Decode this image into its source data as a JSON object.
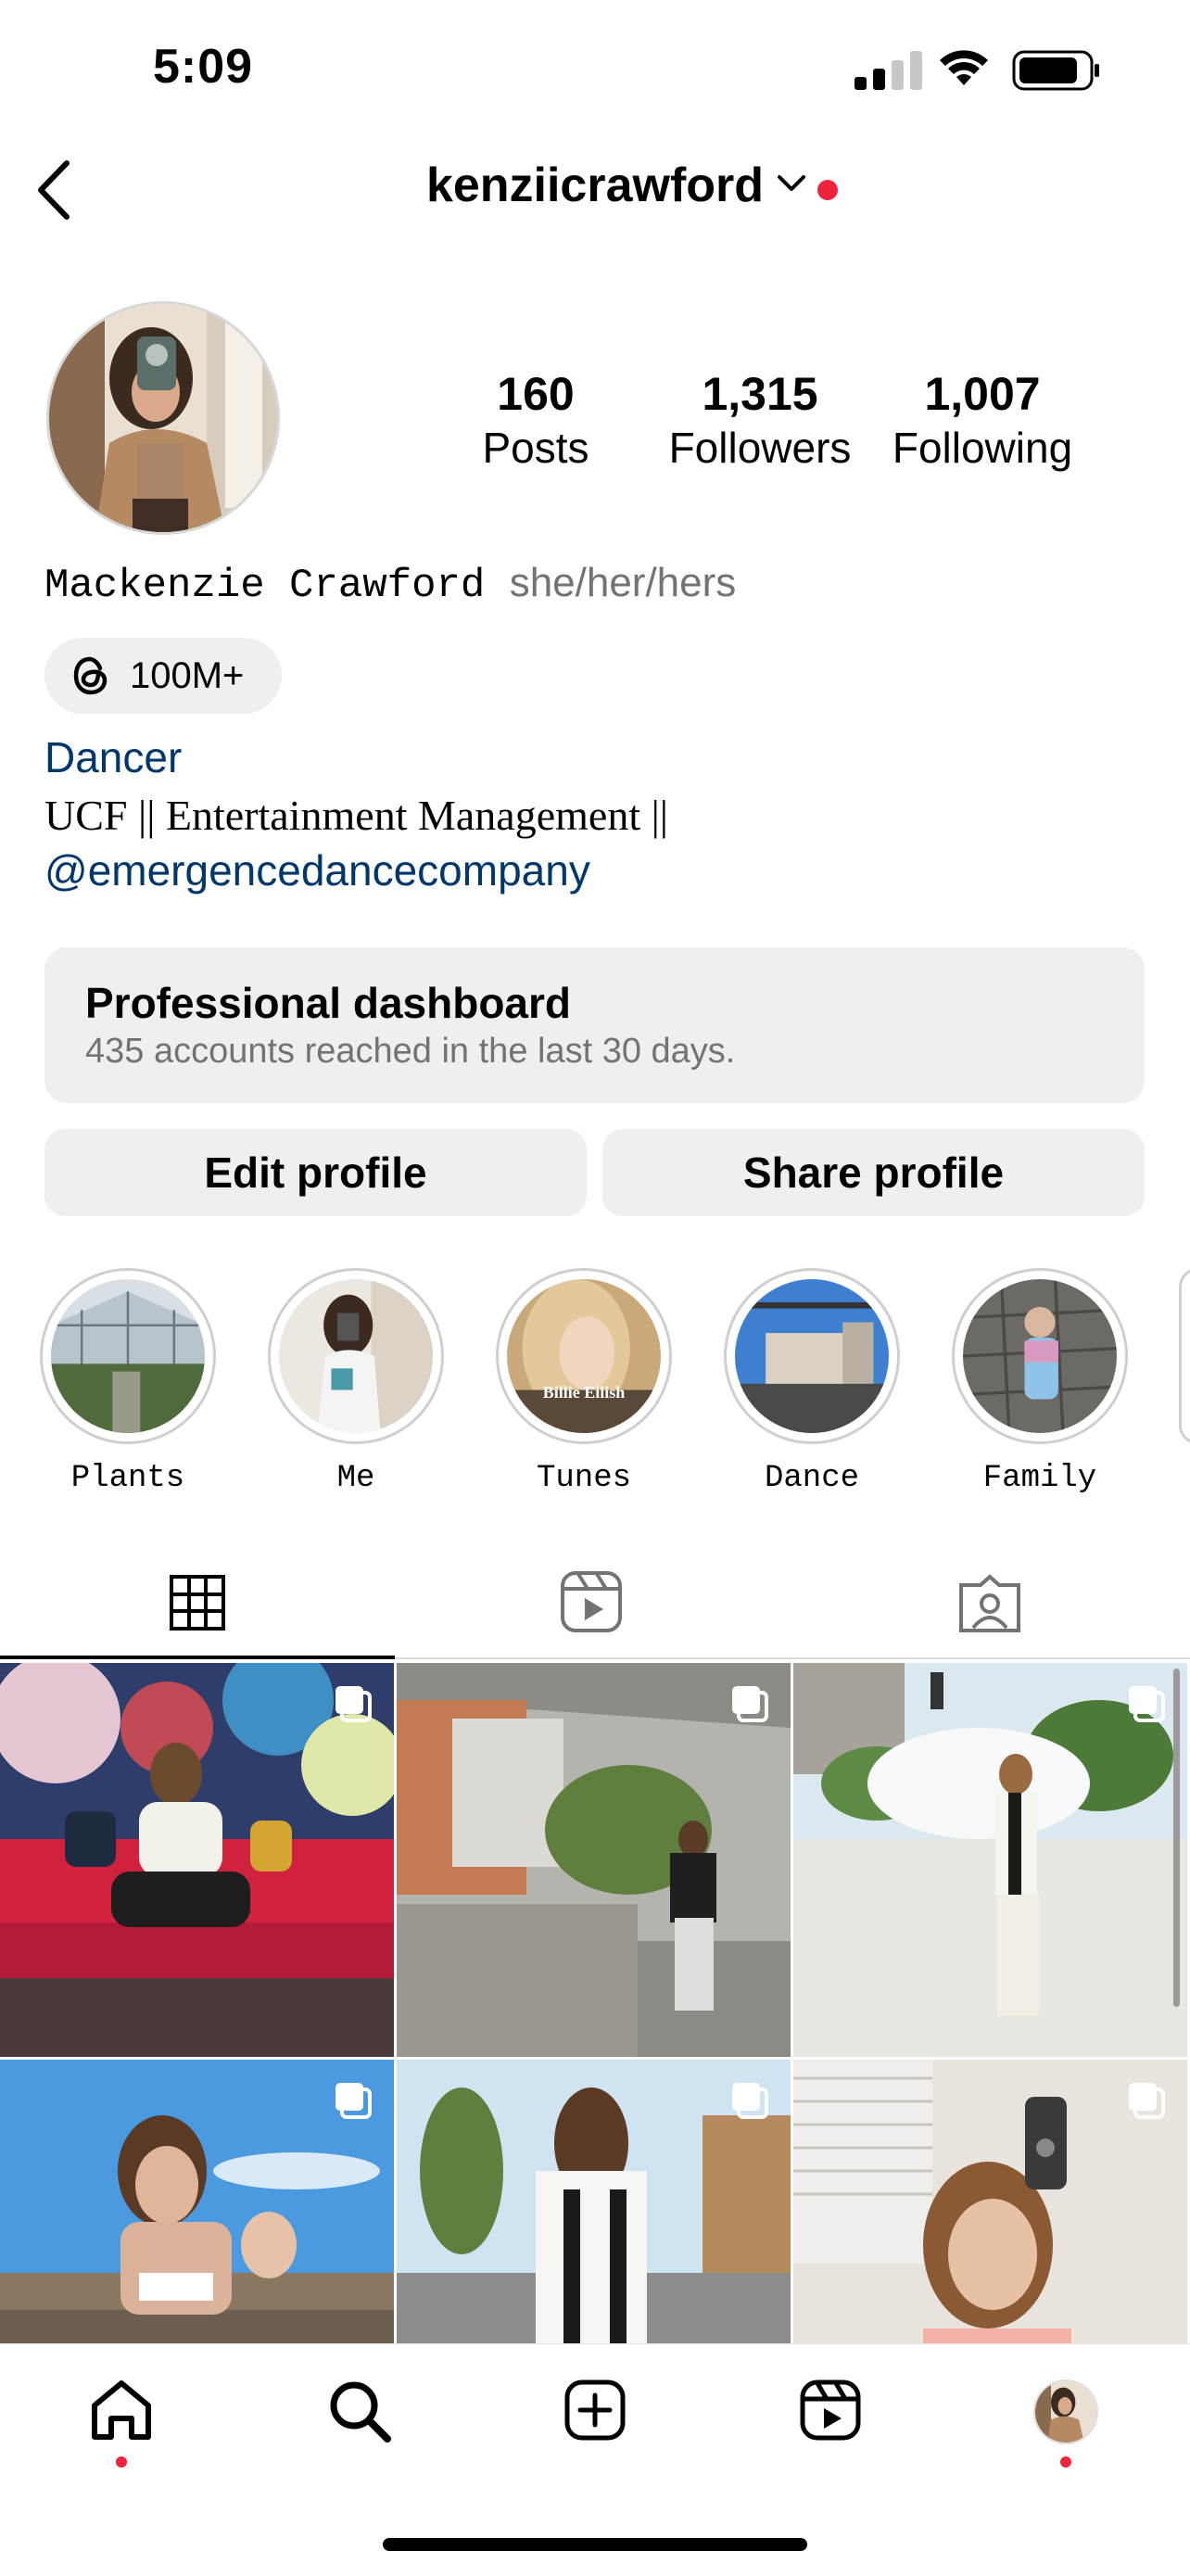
{
  "status_bar": {
    "time": "5:09"
  },
  "header": {
    "username": "kenziicrawford"
  },
  "profile": {
    "stats": [
      {
        "number": "160",
        "label": "Posts"
      },
      {
        "number": "1,315",
        "label": "Followers"
      },
      {
        "number": "1,007",
        "label": "Following"
      }
    ],
    "full_name": "Mackenzie Crawford",
    "pronouns": "she/her/hers",
    "threads_count": "100M+",
    "category": "Dancer",
    "bio": "UCF || Entertainment Management ||",
    "bio_link": "@emergencedancecompany"
  },
  "dashboard": {
    "title": "Professional dashboard",
    "subtitle": "435 accounts reached in the last 30 days."
  },
  "buttons": {
    "edit": "Edit profile",
    "share": "Share profile"
  },
  "highlights": [
    {
      "label": "Plants"
    },
    {
      "label": "Me"
    },
    {
      "label": "Tunes"
    },
    {
      "label": "Dance"
    },
    {
      "label": "Family"
    }
  ],
  "highlight_image_text": "Billie Eilish",
  "colors": {
    "link": "#00376b",
    "notification": "#ef233c",
    "secondary": "#737373",
    "button_bg": "#efefef"
  },
  "icons": [
    "back-icon",
    "chevron-down-icon",
    "threads-icon",
    "grid-icon",
    "reels-icon",
    "tagged-icon",
    "home-icon",
    "search-icon",
    "create-icon",
    "reels-nav-icon",
    "profile-avatar-icon"
  ]
}
